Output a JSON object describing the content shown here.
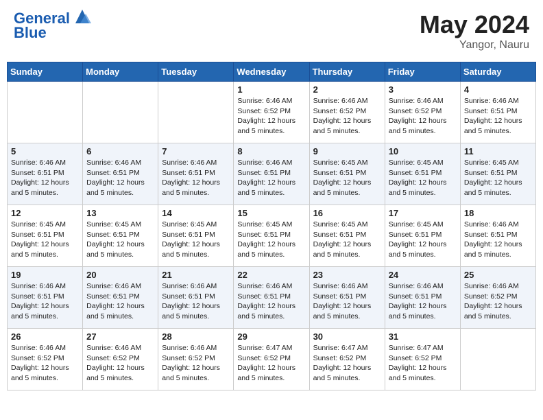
{
  "header": {
    "logo_line1": "General",
    "logo_line2": "Blue",
    "month": "May 2024",
    "location": "Yangor, Nauru"
  },
  "days_of_week": [
    "Sunday",
    "Monday",
    "Tuesday",
    "Wednesday",
    "Thursday",
    "Friday",
    "Saturday"
  ],
  "weeks": [
    [
      {
        "day": "",
        "sunrise": "",
        "sunset": "",
        "daylight": ""
      },
      {
        "day": "",
        "sunrise": "",
        "sunset": "",
        "daylight": ""
      },
      {
        "day": "",
        "sunrise": "",
        "sunset": "",
        "daylight": ""
      },
      {
        "day": "1",
        "sunrise": "6:46 AM",
        "sunset": "6:52 PM",
        "daylight": "12 hours and 5 minutes."
      },
      {
        "day": "2",
        "sunrise": "6:46 AM",
        "sunset": "6:52 PM",
        "daylight": "12 hours and 5 minutes."
      },
      {
        "day": "3",
        "sunrise": "6:46 AM",
        "sunset": "6:52 PM",
        "daylight": "12 hours and 5 minutes."
      },
      {
        "day": "4",
        "sunrise": "6:46 AM",
        "sunset": "6:51 PM",
        "daylight": "12 hours and 5 minutes."
      }
    ],
    [
      {
        "day": "5",
        "sunrise": "6:46 AM",
        "sunset": "6:51 PM",
        "daylight": "12 hours and 5 minutes."
      },
      {
        "day": "6",
        "sunrise": "6:46 AM",
        "sunset": "6:51 PM",
        "daylight": "12 hours and 5 minutes."
      },
      {
        "day": "7",
        "sunrise": "6:46 AM",
        "sunset": "6:51 PM",
        "daylight": "12 hours and 5 minutes."
      },
      {
        "day": "8",
        "sunrise": "6:46 AM",
        "sunset": "6:51 PM",
        "daylight": "12 hours and 5 minutes."
      },
      {
        "day": "9",
        "sunrise": "6:45 AM",
        "sunset": "6:51 PM",
        "daylight": "12 hours and 5 minutes."
      },
      {
        "day": "10",
        "sunrise": "6:45 AM",
        "sunset": "6:51 PM",
        "daylight": "12 hours and 5 minutes."
      },
      {
        "day": "11",
        "sunrise": "6:45 AM",
        "sunset": "6:51 PM",
        "daylight": "12 hours and 5 minutes."
      }
    ],
    [
      {
        "day": "12",
        "sunrise": "6:45 AM",
        "sunset": "6:51 PM",
        "daylight": "12 hours and 5 minutes."
      },
      {
        "day": "13",
        "sunrise": "6:45 AM",
        "sunset": "6:51 PM",
        "daylight": "12 hours and 5 minutes."
      },
      {
        "day": "14",
        "sunrise": "6:45 AM",
        "sunset": "6:51 PM",
        "daylight": "12 hours and 5 minutes."
      },
      {
        "day": "15",
        "sunrise": "6:45 AM",
        "sunset": "6:51 PM",
        "daylight": "12 hours and 5 minutes."
      },
      {
        "day": "16",
        "sunrise": "6:45 AM",
        "sunset": "6:51 PM",
        "daylight": "12 hours and 5 minutes."
      },
      {
        "day": "17",
        "sunrise": "6:45 AM",
        "sunset": "6:51 PM",
        "daylight": "12 hours and 5 minutes."
      },
      {
        "day": "18",
        "sunrise": "6:46 AM",
        "sunset": "6:51 PM",
        "daylight": "12 hours and 5 minutes."
      }
    ],
    [
      {
        "day": "19",
        "sunrise": "6:46 AM",
        "sunset": "6:51 PM",
        "daylight": "12 hours and 5 minutes."
      },
      {
        "day": "20",
        "sunrise": "6:46 AM",
        "sunset": "6:51 PM",
        "daylight": "12 hours and 5 minutes."
      },
      {
        "day": "21",
        "sunrise": "6:46 AM",
        "sunset": "6:51 PM",
        "daylight": "12 hours and 5 minutes."
      },
      {
        "day": "22",
        "sunrise": "6:46 AM",
        "sunset": "6:51 PM",
        "daylight": "12 hours and 5 minutes."
      },
      {
        "day": "23",
        "sunrise": "6:46 AM",
        "sunset": "6:51 PM",
        "daylight": "12 hours and 5 minutes."
      },
      {
        "day": "24",
        "sunrise": "6:46 AM",
        "sunset": "6:51 PM",
        "daylight": "12 hours and 5 minutes."
      },
      {
        "day": "25",
        "sunrise": "6:46 AM",
        "sunset": "6:52 PM",
        "daylight": "12 hours and 5 minutes."
      }
    ],
    [
      {
        "day": "26",
        "sunrise": "6:46 AM",
        "sunset": "6:52 PM",
        "daylight": "12 hours and 5 minutes."
      },
      {
        "day": "27",
        "sunrise": "6:46 AM",
        "sunset": "6:52 PM",
        "daylight": "12 hours and 5 minutes."
      },
      {
        "day": "28",
        "sunrise": "6:46 AM",
        "sunset": "6:52 PM",
        "daylight": "12 hours and 5 minutes."
      },
      {
        "day": "29",
        "sunrise": "6:47 AM",
        "sunset": "6:52 PM",
        "daylight": "12 hours and 5 minutes."
      },
      {
        "day": "30",
        "sunrise": "6:47 AM",
        "sunset": "6:52 PM",
        "daylight": "12 hours and 5 minutes."
      },
      {
        "day": "31",
        "sunrise": "6:47 AM",
        "sunset": "6:52 PM",
        "daylight": "12 hours and 5 minutes."
      },
      {
        "day": "",
        "sunrise": "",
        "sunset": "",
        "daylight": ""
      }
    ]
  ]
}
